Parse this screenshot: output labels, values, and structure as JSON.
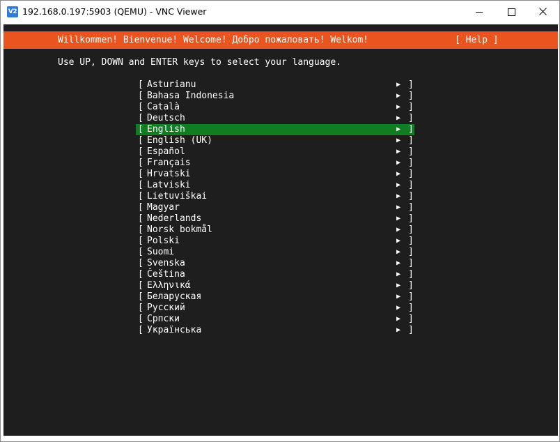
{
  "window": {
    "title": "192.168.0.197:5903 (QEMU) - VNC Viewer",
    "app_icon_label": "V2",
    "icons": {
      "app": "vnc-viewer-icon",
      "minimize": "minimize-icon",
      "maximize": "maximize-icon",
      "close": "close-icon"
    }
  },
  "installer": {
    "welcome": "Willkommen! Bienvenue! Welcome! Добро пожаловать! Welkom!",
    "help": "[ Help ]",
    "instruction": "Use UP, DOWN and ENTER keys to select your language.",
    "bracket_left": "[",
    "bracket_right": "]",
    "arrow": "▶",
    "selected_index": 4,
    "languages": [
      "Asturianu",
      "Bahasa Indonesia",
      "Català",
      "Deutsch",
      "English",
      "English (UK)",
      "Español",
      "Français",
      "Hrvatski",
      "Latviski",
      "Lietuviškai",
      "Magyar",
      "Nederlands",
      "Norsk bokmål",
      "Polski",
      "Suomi",
      "Svenska",
      "Čeština",
      "Ελληνικά",
      "Беларуская",
      "Русский",
      "Српски",
      "Українська"
    ]
  },
  "colors": {
    "banner": "#e9541f",
    "selection": "#0f7d20",
    "terminal_bg": "#1e1e1e",
    "text": "#ffffff"
  }
}
